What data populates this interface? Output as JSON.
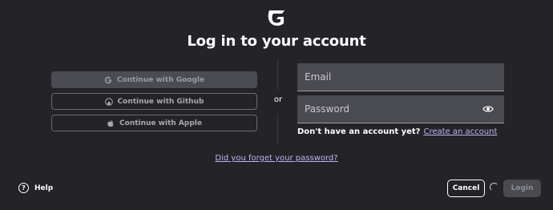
{
  "header": {
    "logo_icon": "g-logo-icon",
    "title": "Log in to your account"
  },
  "social": {
    "google_label": "Continue with Google",
    "google_icon": "google-icon",
    "github_label": "Continue with Github",
    "github_icon": "github-icon",
    "apple_label": "Continue with Apple",
    "apple_icon": "apple-icon"
  },
  "divider_text": "or",
  "form": {
    "email_placeholder": "Email",
    "password_placeholder": "Password",
    "show_password_icon": "eye-icon",
    "signup_prompt": "Don't have an account yet?",
    "signup_link": "Create an account"
  },
  "forgot_link": "Did you forget your password?",
  "footer": {
    "help_label": "Help",
    "help_icon": "question-circle-icon",
    "cancel_label": "Cancel",
    "login_label": "Login",
    "spinner_icon": "loading-spinner-icon"
  },
  "colors": {
    "background": "#232328",
    "field_bg": "#4a4a51",
    "link": "#bcb6f0"
  }
}
